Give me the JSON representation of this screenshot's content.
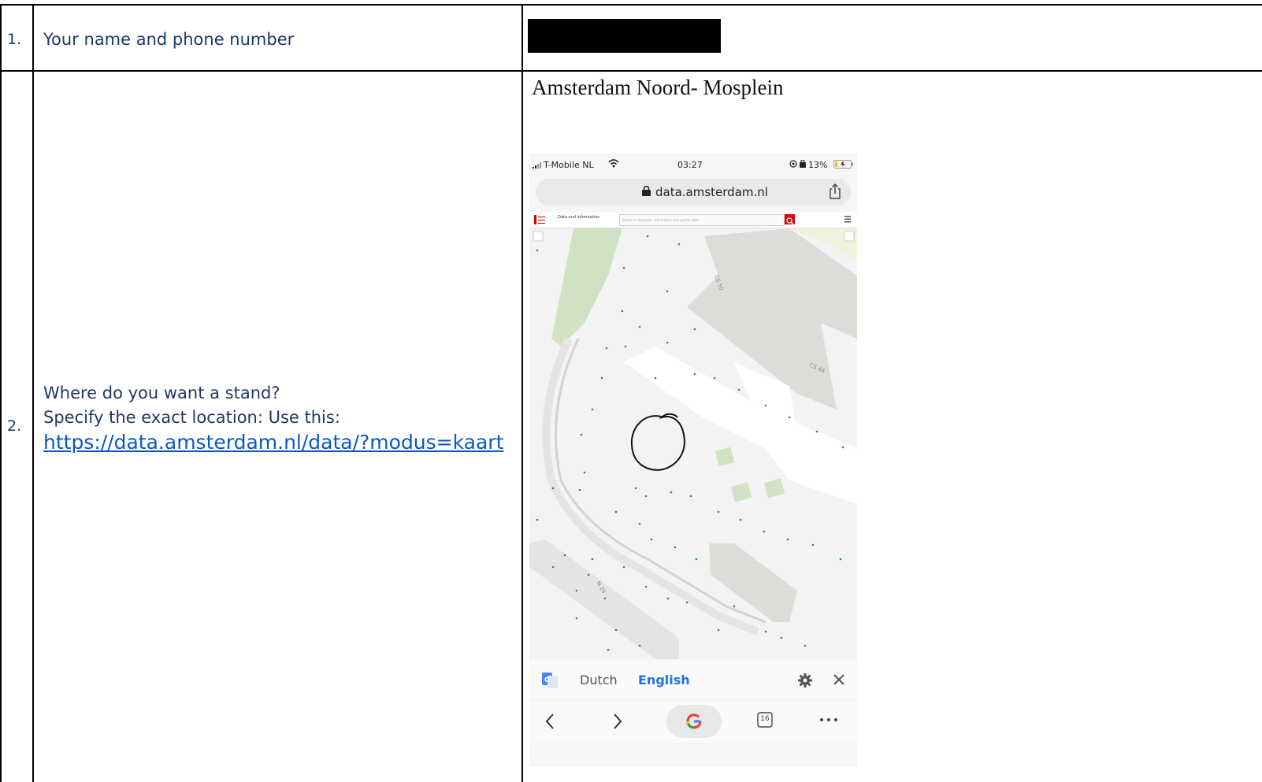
{
  "rows": [
    {
      "number": "1.",
      "question": "Your name and phone number"
    },
    {
      "number": "2.",
      "question_lines": [
        "Where do you want a stand?",
        "Specify the exact location: Use this:"
      ],
      "link_text": "https://data.amsterdam.nl/data/?modus=kaart",
      "answer_title": "Amsterdam Noord- Mosplein"
    }
  ],
  "phone": {
    "carrier": "T-Mobile NL",
    "time": "03:27",
    "battery": "13%",
    "url": "data.amsterdam.nl",
    "site_name": "Data and information",
    "search_placeholder": "Search in datasets, information and spatial data",
    "translate_source": "Dutch",
    "translate_target": "English",
    "tab_count": "16",
    "street_labels": [
      "CS 50",
      "CS 48",
      "N 26"
    ]
  },
  "colors": {
    "question_text": "#1f3864",
    "link": "#0b57c6",
    "map_green": "#cfe3c4",
    "building": "#dcdcd9",
    "dot": "#2a8a6a",
    "translate_target": "#1a73e8"
  }
}
